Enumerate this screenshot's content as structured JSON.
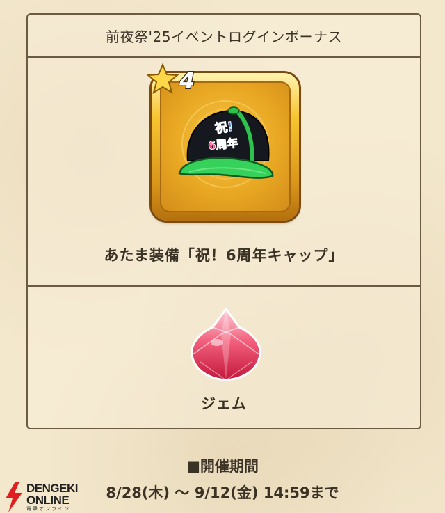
{
  "panel": {
    "title": "前夜祭'25イベントログインボーナス"
  },
  "rewards": [
    {
      "label": "あたま装備「祝！6周年キャップ」",
      "icon": "anniversary-cap-icon",
      "rarity_text": "4",
      "cap_text_line1": "祝!",
      "cap_text_line2": "6周年"
    },
    {
      "label": "ジェム",
      "icon": "gem-icon"
    }
  ],
  "period": {
    "title": "■開催期間",
    "dates": "8/28(木) 〜 9/12(金) 14:59まで"
  },
  "watermark": {
    "line1": "DENGEKI",
    "line2": "ONLINE",
    "line3": "電撃オンライン"
  },
  "colors": {
    "background": "#f3e7cc",
    "border": "#6b5a44",
    "text": "#3b3226",
    "gold": "#f7c531",
    "gem": "#e8425e",
    "watermark_red": "#e02020"
  }
}
